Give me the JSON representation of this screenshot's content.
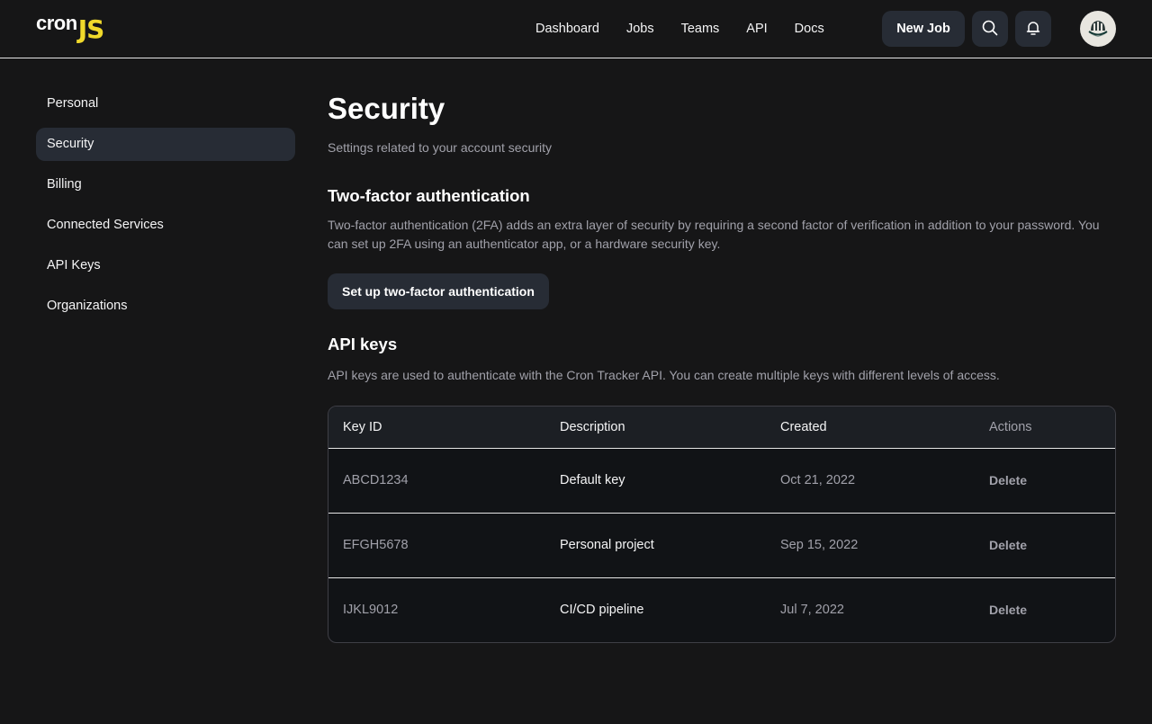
{
  "header": {
    "logo": {
      "part1": "cron",
      "part2": "JS"
    },
    "nav": [
      {
        "label": "Dashboard"
      },
      {
        "label": "Jobs"
      },
      {
        "label": "Teams"
      },
      {
        "label": "API"
      },
      {
        "label": "Docs"
      }
    ],
    "new_job_label": "New Job",
    "icons": {
      "search": "search-icon",
      "notifications": "bell-icon",
      "avatar": "user-avatar"
    }
  },
  "sidebar": {
    "items": [
      {
        "label": "Personal",
        "active": false
      },
      {
        "label": "Security",
        "active": true
      },
      {
        "label": "Billing",
        "active": false
      },
      {
        "label": "Connected Services",
        "active": false
      },
      {
        "label": "API Keys",
        "active": false
      },
      {
        "label": "Organizations",
        "active": false
      }
    ]
  },
  "main": {
    "title": "Security",
    "subtitle": "Settings related to your account security",
    "two_factor": {
      "title": "Two-factor authentication",
      "description": "Two-factor authentication (2FA) adds an extra layer of security by requiring a second factor of verification in addition to your password. You can set up 2FA using an authenticator app, or a hardware security key.",
      "button_label": "Set up two-factor authentication"
    },
    "api_keys": {
      "title": "API keys",
      "description": "API keys are used to authenticate with the Cron Tracker API. You can create multiple keys with different levels of access.",
      "columns": [
        "Key ID",
        "Description",
        "Created",
        "Actions"
      ],
      "rows": [
        {
          "key_id": "ABCD1234",
          "description": "Default key",
          "created": "Oct 21, 2022",
          "action": "Delete"
        },
        {
          "key_id": "EFGH5678",
          "description": "Personal project",
          "created": "Sep 15, 2022",
          "action": "Delete"
        },
        {
          "key_id": "IJKL9012",
          "description": "CI/CD pipeline",
          "created": "Jul 7, 2022",
          "action": "Delete"
        }
      ]
    }
  },
  "colors": {
    "background": "#161617",
    "surface": "#272c35",
    "brand_yellow": "#f0d92b",
    "muted_text": "#a1a1aa"
  }
}
